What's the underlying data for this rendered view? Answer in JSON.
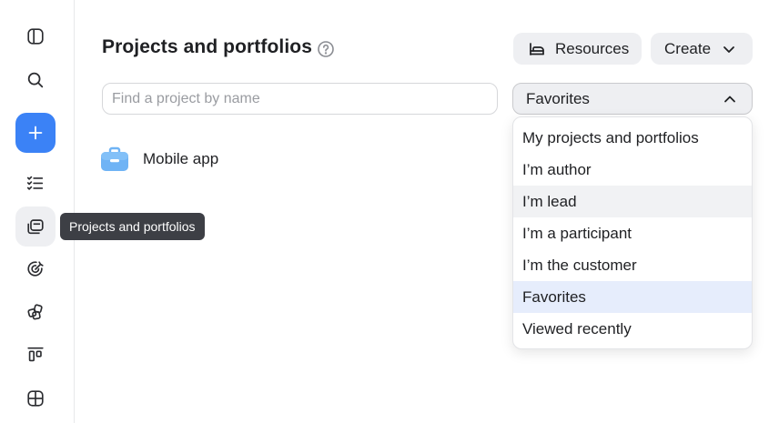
{
  "sidebar": {
    "tooltip": "Projects and portfolios",
    "icons": [
      "panel-toggle-icon",
      "search-icon",
      "plus-icon",
      "task-list-icon",
      "projects-folder-icon",
      "goals-target-icon",
      "components-icon",
      "board-icon",
      "dashboard-grid-icon"
    ]
  },
  "header": {
    "title": "Projects and portfolios",
    "resources_label": "Resources",
    "create_label": "Create"
  },
  "search": {
    "placeholder": "Find a project by name",
    "value": ""
  },
  "filter": {
    "selected": "Favorites",
    "options": [
      "My projects and portfolios",
      "I’m author",
      "I’m lead",
      "I’m a participant",
      "I’m the customer",
      "Favorites",
      "Viewed recently"
    ]
  },
  "projects": [
    {
      "name": "Mobile app",
      "icon": "briefcase-icon"
    }
  ],
  "colors": {
    "accent": "#3b82f6",
    "selected_option_bg": "#e6edfc",
    "hover_bg": "#eeeff2",
    "tooltip_bg": "#3d3f45",
    "project_icon": "#6fb3f5"
  }
}
